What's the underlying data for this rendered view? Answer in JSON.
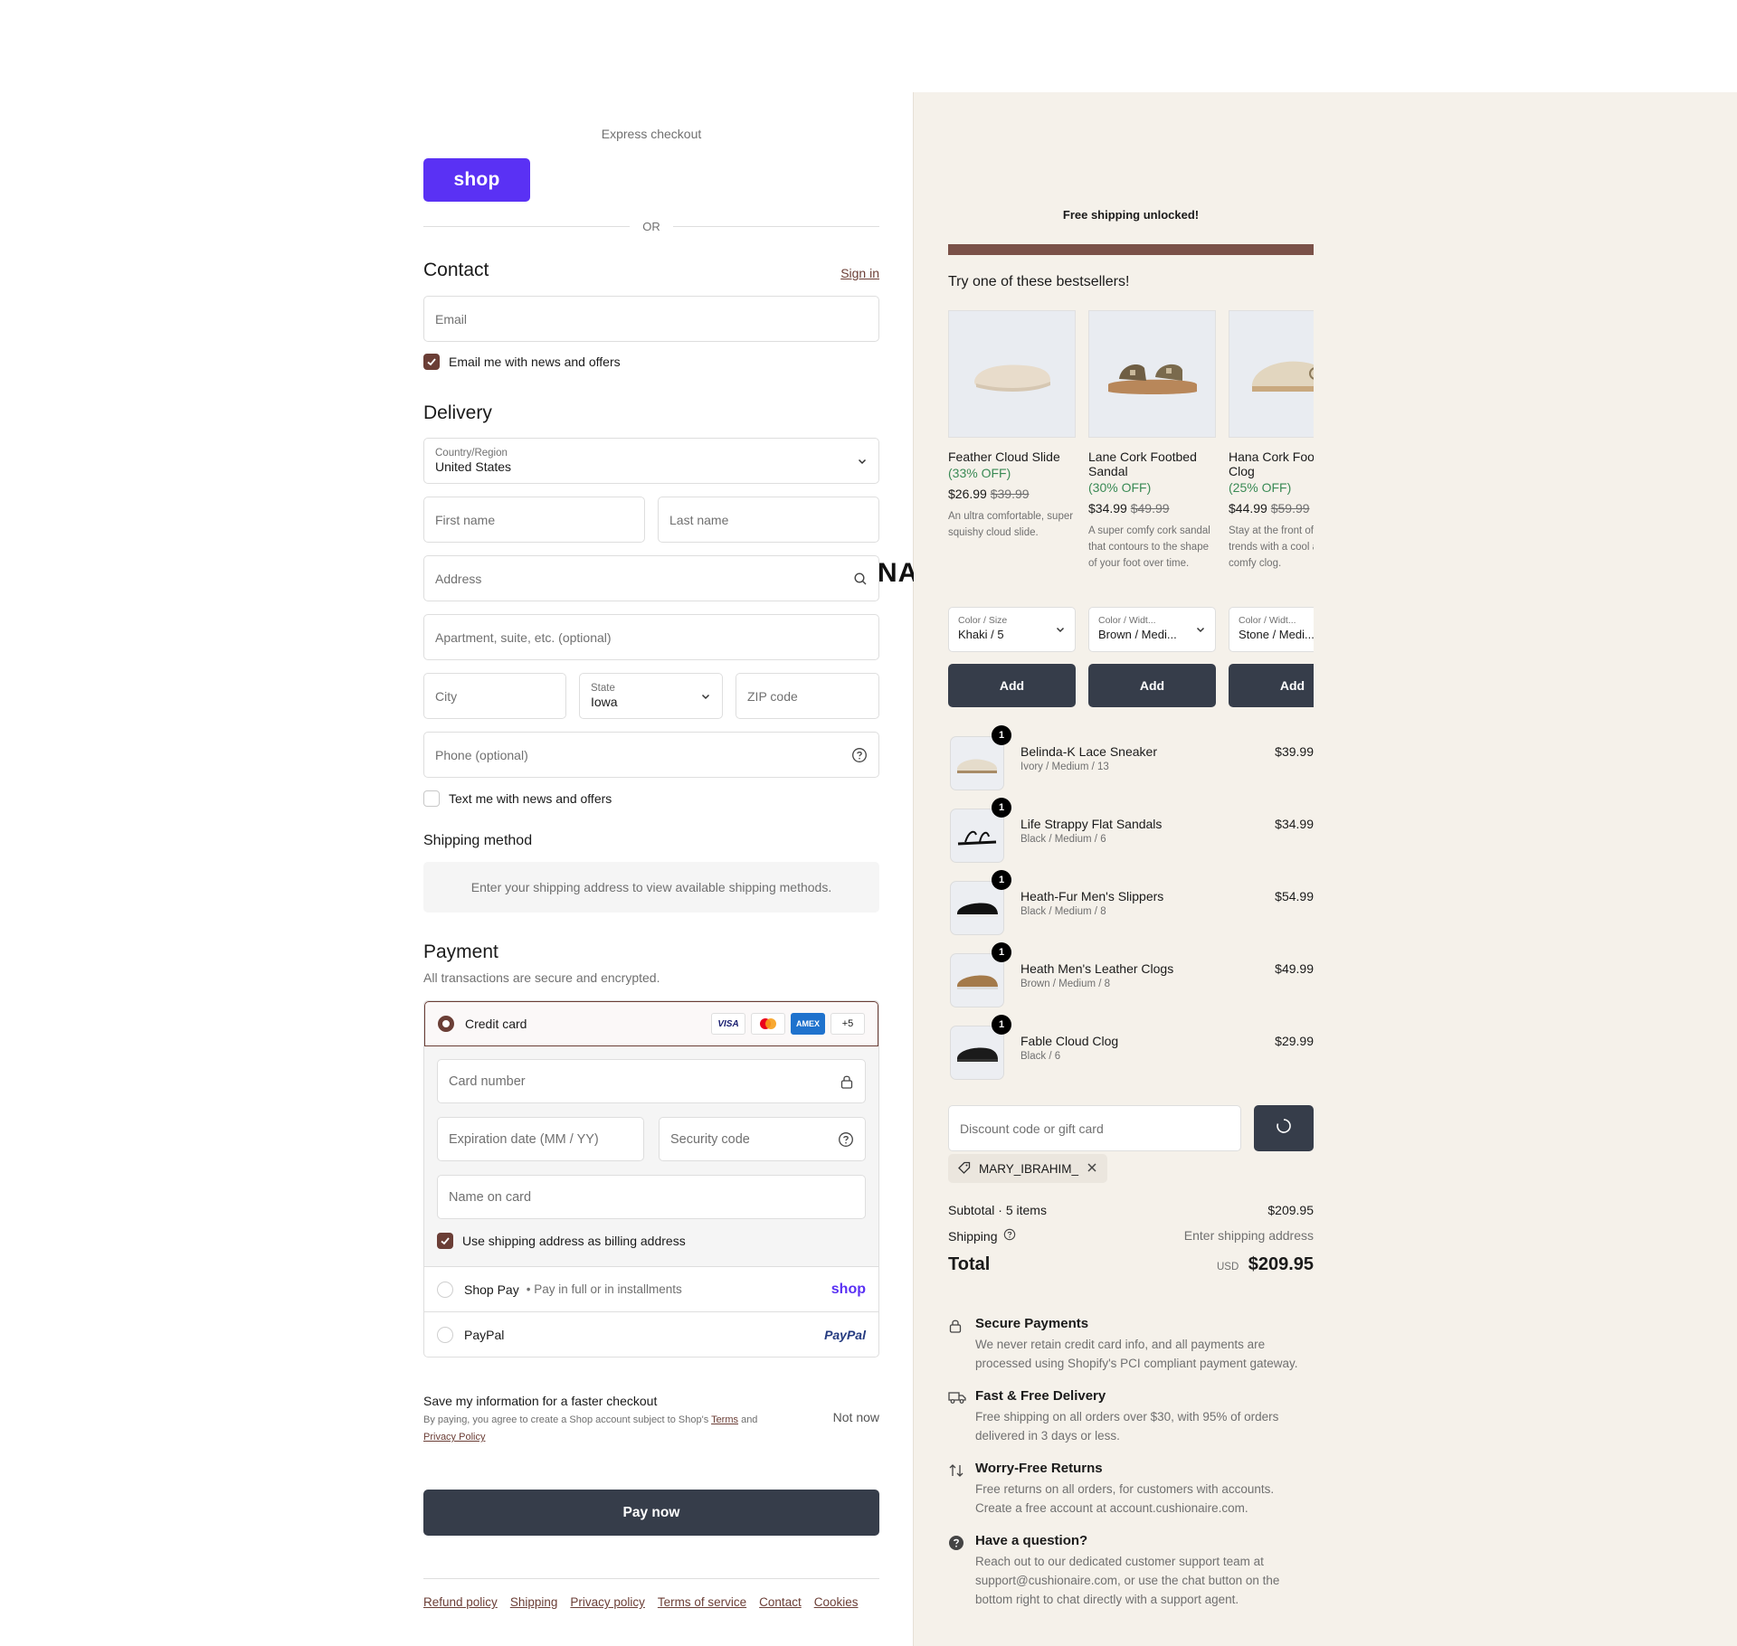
{
  "express": {
    "title": "Express checkout",
    "shop_label": "shop",
    "or_label": "OR"
  },
  "contact": {
    "title": "Contact",
    "sign_in": "Sign in",
    "email_placeholder": "Email",
    "news_label": "Email me with news and offers",
    "news_checked": true
  },
  "delivery": {
    "title": "Delivery",
    "country_label": "Country/Region",
    "country_value": "United States",
    "first_name": "First name",
    "last_name": "Last name",
    "address": "Address",
    "apartment": "Apartment, suite, etc. (optional)",
    "city": "City",
    "state_label": "State",
    "state_value": "Iowa",
    "zip": "ZIP code",
    "phone": "Phone (optional)",
    "text_label": "Text me with news and offers",
    "text_checked": false
  },
  "stray_text": "NA",
  "shipping_method": {
    "title": "Shipping method",
    "info": "Enter your shipping address to view available shipping methods."
  },
  "payment": {
    "title": "Payment",
    "subtitle": "All transactions are secure and encrypted.",
    "credit_card_label": "Credit card",
    "card_brands": [
      "VISA",
      "MC",
      "AMEX",
      "+5"
    ],
    "card_number": "Card number",
    "expiration": "Expiration date (MM / YY)",
    "security_code": "Security code",
    "name_on_card": "Name on card",
    "billing_same": "Use shipping address as billing address",
    "shop_pay_label": "Shop Pay",
    "shop_pay_sub": "Pay in full or in installments",
    "shop_pay_logo": "shop",
    "paypal_label": "PayPal",
    "paypal_logo": "PayPal"
  },
  "save_info": {
    "title": "Save my information for a faster checkout",
    "legal_prefix": "By paying, you agree to create a Shop account subject to Shop's ",
    "terms": "Terms",
    "and": " and",
    "privacy": "Privacy Policy",
    "not_now": "Not now"
  },
  "pay_now": "Pay now",
  "footer_links": [
    "Refund policy",
    "Shipping",
    "Privacy policy",
    "Terms of service",
    "Contact",
    "Cookies"
  ],
  "summary": {
    "free_shipping": "Free shipping unlocked!",
    "free_shipping_progress": 1.0,
    "bestsellers_title": "Try one of these bestsellers!",
    "products": [
      {
        "name": "Feather Cloud Slide",
        "off": "(33% OFF)",
        "price": "$26.99",
        "compare": "$39.99",
        "desc": "An ultra comfortable, super squishy cloud slide.",
        "sel_label": "Color / Size",
        "sel_value": "Khaki / 5",
        "add": "Add"
      },
      {
        "name": "Lane Cork Footbed Sandal",
        "off": "(30% OFF)",
        "price": "$34.99",
        "compare": "$49.99",
        "desc": "A super comfy cork sandal that contours to the shape of your foot over time.",
        "sel_label": "Color / Widt...",
        "sel_value": "Brown / Medi...",
        "add": "Add"
      },
      {
        "name": "Hana Cork Footbed Clog",
        "off": "(25% OFF)",
        "price": "$44.99",
        "compare": "$59.99",
        "desc": "Stay at the front of fashion trends with a cool and comfy clog.",
        "sel_label": "Color / Widt...",
        "sel_value": "Stone / Medi...",
        "add": "Add"
      }
    ],
    "items": [
      {
        "qty": "1",
        "name": "Belinda-K Lace Sneaker",
        "variant": "Ivory / Medium / 13",
        "price": "$39.99"
      },
      {
        "qty": "1",
        "name": "Life Strappy Flat Sandals",
        "variant": "Black / Medium / 6",
        "price": "$34.99"
      },
      {
        "qty": "1",
        "name": "Heath-Fur Men's Slippers",
        "variant": "Black / Medium / 8",
        "price": "$54.99"
      },
      {
        "qty": "1",
        "name": "Heath Men's Leather Clogs",
        "variant": "Brown / Medium / 8",
        "price": "$49.99"
      },
      {
        "qty": "1",
        "name": "Fable Cloud Clog",
        "variant": "Black / 6",
        "price": "$29.99"
      }
    ],
    "discount_placeholder": "Discount code or gift card",
    "applied_code": "MARY_IBRAHIM_",
    "subtotal_label": "Subtotal · 5 items",
    "subtotal": "$209.95",
    "shipping_label": "Shipping",
    "shipping_value": "Enter shipping address",
    "total_label": "Total",
    "currency": "USD",
    "total": "$209.95"
  },
  "trust": [
    {
      "icon": "lock-icon",
      "title": "Secure Payments",
      "desc": "We never retain credit card info, and all payments are processed using Shopify's PCI compliant payment gateway."
    },
    {
      "icon": "truck-icon",
      "title": "Fast & Free Delivery",
      "desc": "Free shipping on all orders over $30, with 95% of orders delivered in 3 days or less."
    },
    {
      "icon": "returns-icon",
      "title": "Worry-Free Returns",
      "desc": "Free returns on all orders, for customers with accounts. Create a free account at account.cushionaire.com."
    },
    {
      "icon": "question-icon",
      "title": "Have a question?",
      "desc": "Reach out to our dedicated customer support team at support@cushionaire.com, or use the chat button on the bottom right to chat directly with a support agent."
    }
  ],
  "colors": {
    "accent": "#6b3e36",
    "button_dark": "#363d4a",
    "shop_purple": "#5a31f4",
    "summary_bg": "#f5f1ea"
  }
}
